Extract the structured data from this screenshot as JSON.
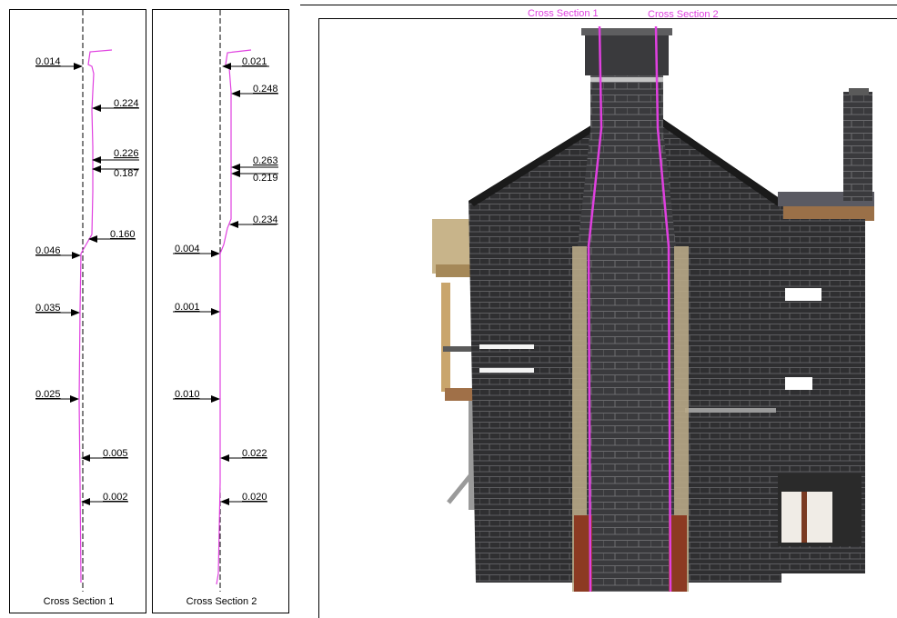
{
  "sections": [
    {
      "caption": "Cross Section 1",
      "measurements": [
        "0.014",
        "0.224",
        "0.226",
        "0.187",
        "0.046",
        "0.160",
        "0.035",
        "0.025",
        "0.005",
        "0.002"
      ]
    },
    {
      "caption": "Cross Section 2",
      "measurements": [
        "0.021",
        "0.248",
        "0.263",
        "0.219",
        "0.004",
        "0.234",
        "0.001",
        "0.010",
        "0.022",
        "0.020"
      ]
    }
  ],
  "model_view": {
    "section_label_1": "Cross Section 1",
    "section_label_2": "Cross Section 2"
  },
  "colors": {
    "profile_line": "#e040e0",
    "stone_dark": "#2e2e30",
    "mortar": "#8a8a8a",
    "render": "#c8b89a",
    "brick": "#8c3a22"
  }
}
